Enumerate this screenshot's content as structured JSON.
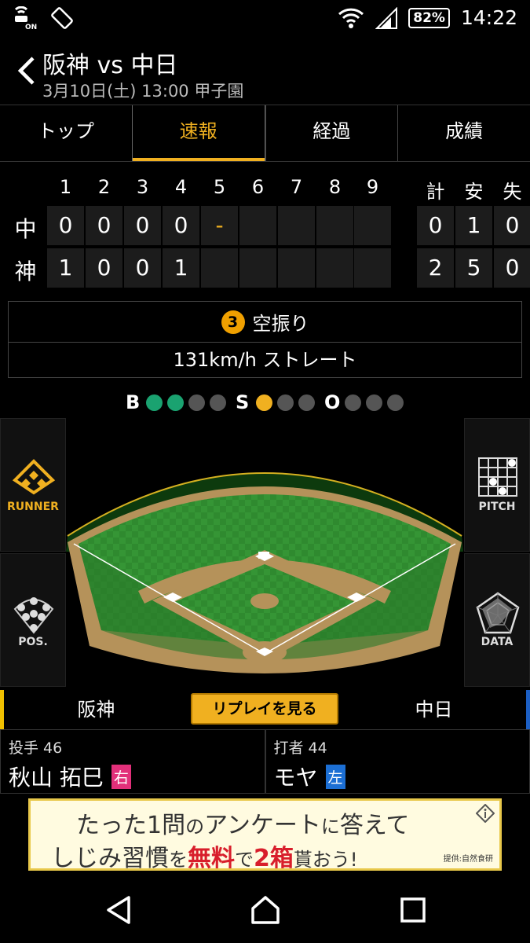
{
  "status_bar": {
    "battery": "82%",
    "time": "14:22",
    "icons": [
      "nfc-on-icon",
      "auto-rotate-icon",
      "wifi-icon",
      "signal-icon",
      "battery-icon"
    ]
  },
  "header": {
    "title": "阪神 vs 中日",
    "subtitle": "3月10日(土) 13:00 甲子園"
  },
  "tabs": [
    {
      "label": "トップ",
      "active": false
    },
    {
      "label": "速報",
      "active": true
    },
    {
      "label": "経過",
      "active": false
    },
    {
      "label": "成績",
      "active": false
    }
  ],
  "scoreboard": {
    "innings": [
      "1",
      "2",
      "3",
      "4",
      "5",
      "6",
      "7",
      "8",
      "9"
    ],
    "totals_headers": [
      "計",
      "安",
      "失"
    ],
    "teams": [
      {
        "label": "中",
        "innings": [
          "0",
          "0",
          "0",
          "0",
          "-",
          "",
          "",
          "",
          ""
        ],
        "totals": [
          "0",
          "1",
          "0"
        ]
      },
      {
        "label": "神",
        "innings": [
          "1",
          "0",
          "0",
          "1",
          "",
          "",
          "",
          "",
          ""
        ],
        "totals": [
          "2",
          "5",
          "0"
        ]
      }
    ]
  },
  "pitch": {
    "number": "3",
    "result": "空振り",
    "speed_type": "131km/h ストレート"
  },
  "count": {
    "ball_label": "B",
    "balls": 2,
    "ball_max": 4,
    "strike_label": "S",
    "strikes": 1,
    "strike_max": 3,
    "out_label": "O",
    "outs": 0,
    "out_max": 3
  },
  "side_buttons": {
    "runner": "RUNNER",
    "pitch": "PITCH",
    "pos": "POS.",
    "data": "DATA"
  },
  "team_bar": {
    "home": "阪神",
    "replay": "リプレイを見る",
    "away": "中日"
  },
  "players": {
    "pitcher_role": "投手 46",
    "pitcher_name": "秋山 拓巳",
    "pitcher_hand": "右",
    "batter_role": "打者 44",
    "batter_name": "モヤ",
    "batter_hand": "左"
  },
  "ad": {
    "line1_a": "たった1問",
    "line1_b": "の",
    "line1_c": "アンケート",
    "line1_d": "に",
    "line1_e": "答えて",
    "line2_a": "しじみ習慣",
    "line2_b": "を",
    "line2_c": "無料",
    "line2_d": "で",
    "line2_e": "2箱",
    "line2_f": "貰おう!",
    "credit": "提供:自然食研"
  },
  "colors": {
    "accent": "#f0b020",
    "ball_green": "#1aa270",
    "home_team": "#f0c000",
    "away_team": "#1c5fc4",
    "right_hand": "#e2307a",
    "left_hand": "#1c6fd4"
  }
}
